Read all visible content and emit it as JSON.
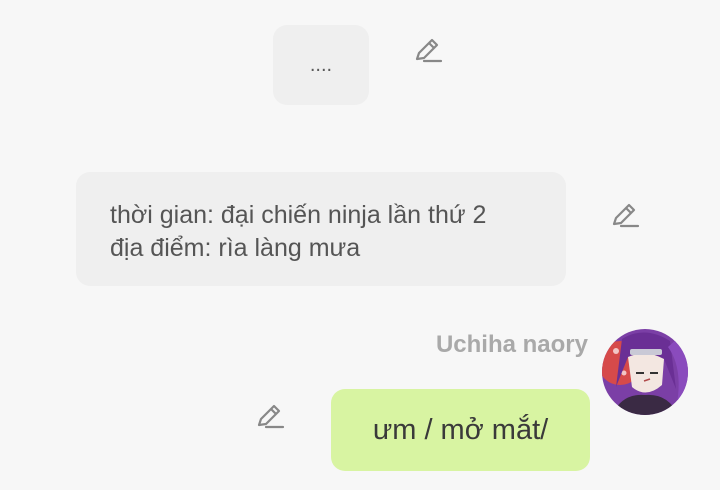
{
  "messages": [
    {
      "text": "....",
      "edit_icon": "edit-pencil-icon"
    },
    {
      "lines": [
        "thời gian: đại chiến ninja lần thứ 2",
        "địa điểm: rìa làng mưa"
      ],
      "edit_icon": "edit-pencil-icon"
    }
  ],
  "user_message": {
    "sender": "Uchiha naory",
    "text": "ưm / mở mắt/",
    "avatar": "character-avatar",
    "edit_icon": "edit-pencil-icon"
  },
  "colors": {
    "background": "#f7f7f7",
    "bot_bubble": "#efefef",
    "user_bubble": "#d8f4a2",
    "sender_name": "#a9a9a9",
    "icon": "#888888"
  }
}
